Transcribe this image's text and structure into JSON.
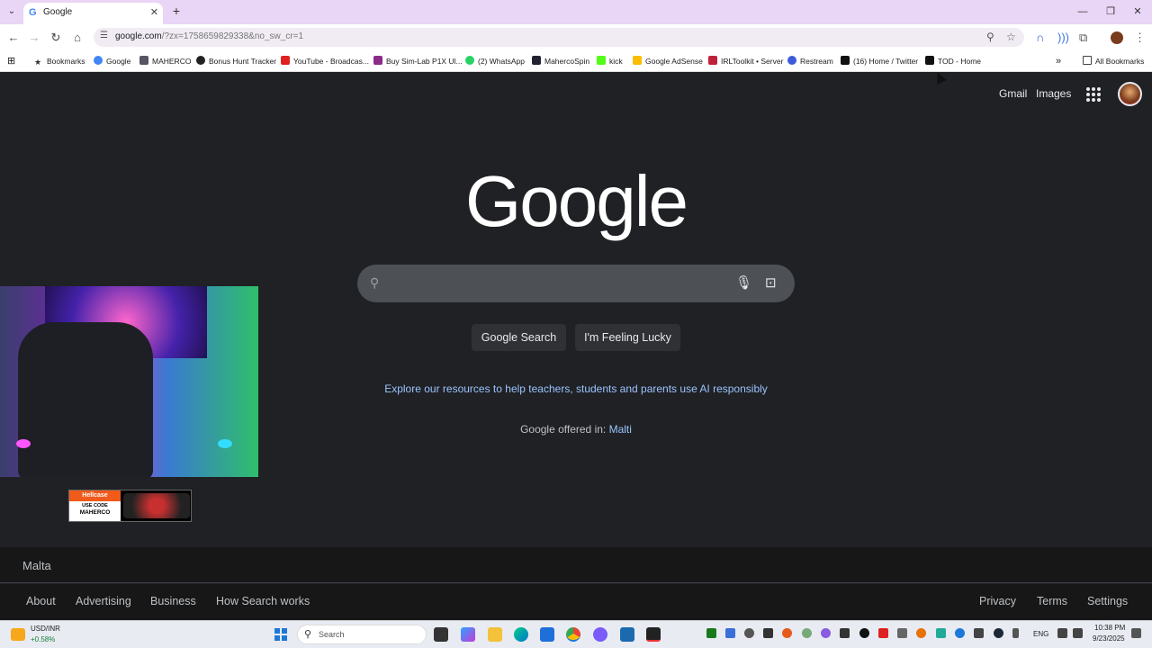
{
  "browser": {
    "tab": {
      "title": "Google",
      "favicon": "G"
    },
    "new_tab_symbol": "+",
    "url_main": "google.com",
    "url_rest": "/?zx=1758659829338&no_sw_cr=1"
  },
  "bookmarks": {
    "items": [
      "Bookmarks",
      "Google",
      "MAHERCO",
      "Bonus Hunt Tracker",
      "YouTube - Broadcas...",
      "Buy Sim-Lab P1X Ul...",
      "(2) WhatsApp",
      "MahercoSpin",
      "kick",
      "Google AdSense",
      "IRLToolkit • Server",
      "Restream",
      "(16) Home / Twitter",
      "TOD - Home"
    ],
    "more": "»",
    "all_bookmarks": "All Bookmarks"
  },
  "google": {
    "gmail": "Gmail",
    "images": "Images",
    "logo": "Google",
    "search_button": "Google Search",
    "lucky_button": "I'm Feeling Lucky",
    "explore_link": "Explore our resources to help teachers, students and parents use AI responsibly",
    "offered_prefix": "Google offered in: ",
    "offered_language": "Malti",
    "country": "Malta",
    "footer_left": [
      "About",
      "Advertising",
      "Business",
      "How Search works"
    ],
    "footer_right": [
      "Privacy",
      "Terms",
      "Settings"
    ]
  },
  "overlay": {
    "promo_brand": "Hellcase",
    "promo_line1": "USE CODE",
    "promo_line2": "MAHERCO"
  },
  "taskbar": {
    "ticker_name": "USD/INR",
    "ticker_delta": "+0.58%",
    "search_label": "Search",
    "lang": "ENG",
    "time": "10:38 PM",
    "date": "9/23/2025"
  },
  "colors": {
    "page_bg": "#202124",
    "link": "#99c3ff",
    "tabstrip": "#e9d5f5"
  }
}
